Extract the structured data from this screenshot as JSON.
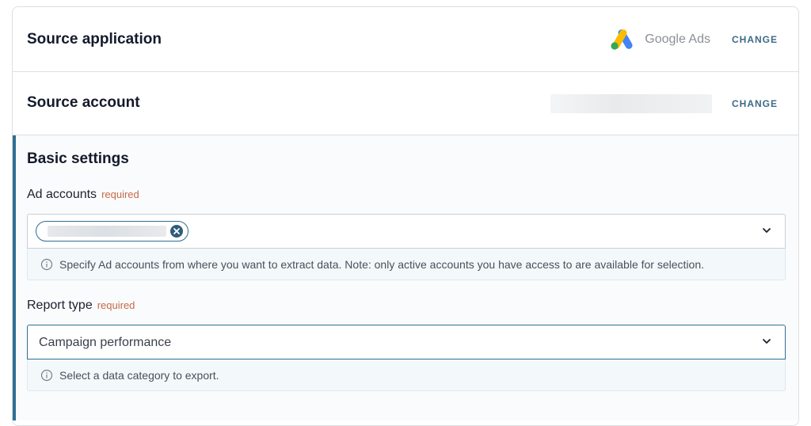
{
  "source_application": {
    "title": "Source application",
    "app_name": "Google Ads",
    "app_icon": "google-ads-logo",
    "change_label": "CHANGE"
  },
  "source_account": {
    "title": "Source account",
    "change_label": "CHANGE"
  },
  "basic_settings": {
    "title": "Basic settings",
    "ad_accounts": {
      "label": "Ad accounts",
      "required_label": "required",
      "hint": "Specify Ad accounts from where you want to extract data. Note: only active accounts you have access to are available for selection."
    },
    "report_type": {
      "label": "Report type",
      "required_label": "required",
      "value": "Campaign performance",
      "hint": "Select a data category to export."
    }
  },
  "colors": {
    "accent": "#2f6f92",
    "required": "#c86a48",
    "change": "#3d6a86"
  }
}
